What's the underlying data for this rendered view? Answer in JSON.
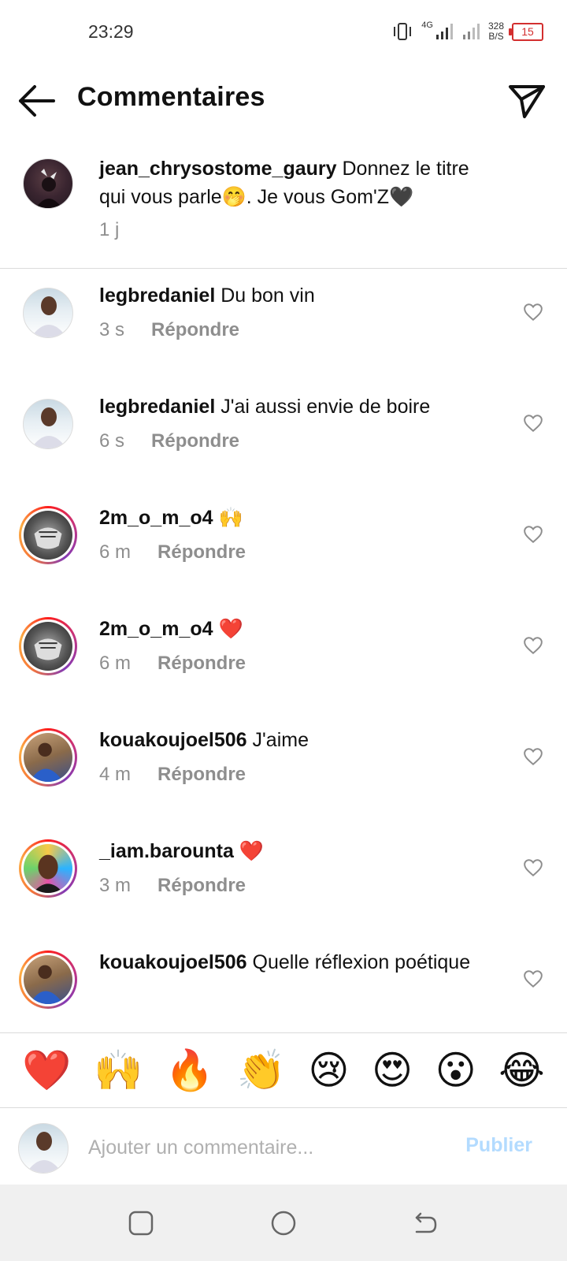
{
  "status_bar": {
    "time": "23:29",
    "network": "4G",
    "speed_value": "328",
    "speed_unit": "B/S",
    "battery": "15"
  },
  "header": {
    "title": "Commentaires"
  },
  "caption": {
    "username": "jean_chrysostome_gaury",
    "text": "Donnez le titre qui vous parle🤭. Je vous Gom'Z🖤",
    "time": "1 j"
  },
  "reply_label": "Répondre",
  "comments": [
    {
      "username": "legbredaniel",
      "text": "Du bon vin",
      "time": "3 s"
    },
    {
      "username": "legbredaniel",
      "text": "J'ai aussi envie de boire",
      "time": "6 s"
    },
    {
      "username": "2m_o_m_o4",
      "text": "🙌",
      "time": "6 m"
    },
    {
      "username": "2m_o_m_o4",
      "text": "❤️",
      "time": "6 m"
    },
    {
      "username": "kouakoujoel506",
      "text": "J'aime",
      "time": "4 m"
    },
    {
      "username": "_iam.barounta",
      "text": "❤️",
      "time": "3 m"
    },
    {
      "username": "kouakoujoel506",
      "text": "Quelle réflexion poétique",
      "time": ""
    }
  ],
  "emoji_bar": [
    "❤️",
    "🙌",
    "🔥",
    "👏",
    "😢",
    "😍",
    "😮",
    "😂"
  ],
  "input": {
    "placeholder": "Ajouter un commentaire...",
    "publish_label": "Publier"
  },
  "colors": {
    "accent_disabled": "#b3dbff",
    "secondary_text": "#8e8e8e",
    "battery_low": "#d32f2f"
  }
}
